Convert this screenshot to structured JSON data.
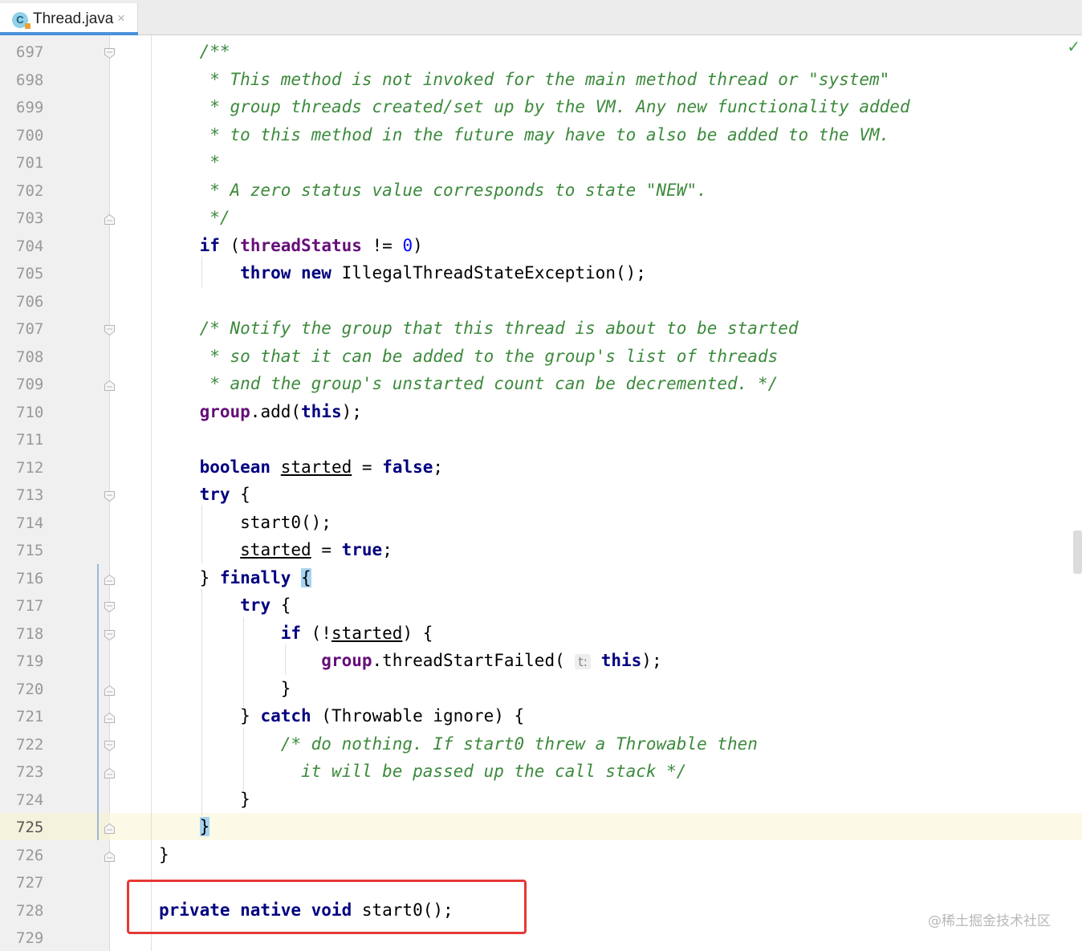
{
  "tab": {
    "icon_letter": "C",
    "title": "Thread.java",
    "close_glyph": "×"
  },
  "editor": {
    "status_glyph": "✓",
    "current_line": "725",
    "watermark": "@稀土掘金技术社区",
    "highlighted_code": "private native void start0();"
  },
  "lines": [
    {
      "n": "697",
      "fold": "open",
      "tokens": [
        {
          "t": "    /**",
          "s": "cm"
        }
      ]
    },
    {
      "n": "698",
      "tokens": [
        {
          "t": "     * This method is not invoked for the main method thread or \"system\"",
          "s": "cm"
        }
      ]
    },
    {
      "n": "699",
      "tokens": [
        {
          "t": "     * group threads created/set up by the VM. Any new functionality added",
          "s": "cm"
        }
      ]
    },
    {
      "n": "700",
      "tokens": [
        {
          "t": "     * to this method in the future may have to also be added to the VM.",
          "s": "cm"
        }
      ]
    },
    {
      "n": "701",
      "tokens": [
        {
          "t": "     *",
          "s": "cm"
        }
      ]
    },
    {
      "n": "702",
      "tokens": [
        {
          "t": "     * A zero status value corresponds to state \"NEW\".",
          "s": "cm"
        }
      ]
    },
    {
      "n": "703",
      "fold": "end",
      "tokens": [
        {
          "t": "     */",
          "s": "cm"
        }
      ]
    },
    {
      "n": "704",
      "tokens": [
        {
          "t": "    ",
          "s": ""
        },
        {
          "t": "if",
          "s": "kw"
        },
        {
          "t": " (",
          "s": ""
        },
        {
          "t": "threadStatus",
          "s": "fld"
        },
        {
          "t": " != ",
          "s": ""
        },
        {
          "t": "0",
          "s": "num"
        },
        {
          "t": ")",
          "s": ""
        }
      ]
    },
    {
      "n": "705",
      "tokens": [
        {
          "t": "        ",
          "s": ""
        },
        {
          "t": "throw new",
          "s": "kw"
        },
        {
          "t": " IllegalThreadStateException();",
          "s": ""
        }
      ]
    },
    {
      "n": "706",
      "tokens": []
    },
    {
      "n": "707",
      "fold": "open",
      "tokens": [
        {
          "t": "    /* Notify the group that this thread is about to be started",
          "s": "cm"
        }
      ]
    },
    {
      "n": "708",
      "tokens": [
        {
          "t": "     * so that it can be added to the group's list of threads",
          "s": "cm"
        }
      ]
    },
    {
      "n": "709",
      "fold": "end",
      "tokens": [
        {
          "t": "     * and the group's unstarted count can be decremented. */",
          "s": "cm"
        }
      ]
    },
    {
      "n": "710",
      "tokens": [
        {
          "t": "    ",
          "s": ""
        },
        {
          "t": "group",
          "s": "fld"
        },
        {
          "t": ".add(",
          "s": ""
        },
        {
          "t": "this",
          "s": "kw"
        },
        {
          "t": ");",
          "s": ""
        }
      ]
    },
    {
      "n": "711",
      "tokens": []
    },
    {
      "n": "712",
      "tokens": [
        {
          "t": "    ",
          "s": ""
        },
        {
          "t": "boolean",
          "s": "kw"
        },
        {
          "t": " ",
          "s": ""
        },
        {
          "t": "started",
          "s": "ul"
        },
        {
          "t": " = ",
          "s": ""
        },
        {
          "t": "false",
          "s": "kw"
        },
        {
          "t": ";",
          "s": ""
        }
      ]
    },
    {
      "n": "713",
      "fold": "open",
      "tokens": [
        {
          "t": "    ",
          "s": ""
        },
        {
          "t": "try",
          "s": "kw"
        },
        {
          "t": " {",
          "s": ""
        }
      ]
    },
    {
      "n": "714",
      "tokens": [
        {
          "t": "        start0();",
          "s": ""
        }
      ]
    },
    {
      "n": "715",
      "tokens": [
        {
          "t": "        ",
          "s": ""
        },
        {
          "t": "started",
          "s": "ul"
        },
        {
          "t": " = ",
          "s": ""
        },
        {
          "t": "true",
          "s": "kw"
        },
        {
          "t": ";",
          "s": ""
        }
      ]
    },
    {
      "n": "716",
      "fold": "end",
      "tokens": [
        {
          "t": "    } ",
          "s": ""
        },
        {
          "t": "finally",
          "s": "kw"
        },
        {
          "t": " ",
          "s": ""
        },
        {
          "t": "{",
          "s": "brace-hl"
        }
      ]
    },
    {
      "n": "717",
      "fold": "open",
      "tokens": [
        {
          "t": "        ",
          "s": ""
        },
        {
          "t": "try",
          "s": "kw"
        },
        {
          "t": " {",
          "s": ""
        }
      ]
    },
    {
      "n": "718",
      "fold": "open",
      "tokens": [
        {
          "t": "            ",
          "s": ""
        },
        {
          "t": "if",
          "s": "kw"
        },
        {
          "t": " (!",
          "s": ""
        },
        {
          "t": "started",
          "s": "ul"
        },
        {
          "t": ") {",
          "s": ""
        }
      ]
    },
    {
      "n": "719",
      "tokens": [
        {
          "t": "                ",
          "s": ""
        },
        {
          "t": "group",
          "s": "fld"
        },
        {
          "t": ".threadStartFailed( ",
          "s": ""
        },
        {
          "t": "t:",
          "s": "hint"
        },
        {
          "t": " ",
          "s": ""
        },
        {
          "t": "this",
          "s": "kw"
        },
        {
          "t": ");",
          "s": ""
        }
      ]
    },
    {
      "n": "720",
      "fold": "end",
      "tokens": [
        {
          "t": "            }",
          "s": ""
        }
      ]
    },
    {
      "n": "721",
      "fold": "end",
      "tokens": [
        {
          "t": "        } ",
          "s": ""
        },
        {
          "t": "catch",
          "s": "kw"
        },
        {
          "t": " (Throwable ignore) {",
          "s": ""
        }
      ]
    },
    {
      "n": "722",
      "fold": "open",
      "tokens": [
        {
          "t": "            /* do nothing. If start0 threw a Throwable then",
          "s": "cm"
        }
      ]
    },
    {
      "n": "723",
      "fold": "end",
      "tokens": [
        {
          "t": "              it will be passed up the call stack */",
          "s": "cm"
        }
      ]
    },
    {
      "n": "724",
      "tokens": [
        {
          "t": "        }",
          "s": ""
        }
      ]
    },
    {
      "n": "725",
      "fold": "end",
      "tokens": [
        {
          "t": "    ",
          "s": ""
        },
        {
          "t": "}",
          "s": "brace-hl"
        }
      ]
    },
    {
      "n": "726",
      "fold": "end",
      "tokens": [
        {
          "t": "}",
          "s": ""
        }
      ]
    },
    {
      "n": "727",
      "tokens": []
    },
    {
      "n": "728",
      "tokens": [
        {
          "t": "private native void",
          "s": "kw"
        },
        {
          "t": " start0();",
          "s": ""
        }
      ]
    },
    {
      "n": "729",
      "tokens": []
    }
  ],
  "colors": {
    "keyword": "#000080",
    "comment": "#3c8a3c",
    "field": "#660e7a",
    "number": "#0000ff",
    "highlight_box": "#e53935",
    "status_ok": "#3fa142"
  }
}
